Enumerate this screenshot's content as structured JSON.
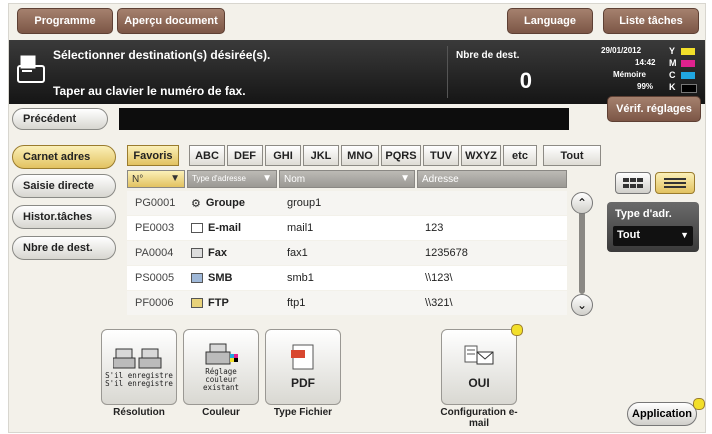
{
  "top_tabs": {
    "programme": "Programme",
    "apercu": "Aperçu document",
    "language": "Language",
    "liste": "Liste tâches"
  },
  "header": {
    "line1": "Sélectionner destination(s) désirée(s).",
    "line2": "Taper au clavier le numéro de fax.",
    "nbre_label": "Nbre de dest.",
    "nbre_value": "0",
    "datetime": "29/01/2012",
    "time": "14:42",
    "memory_label": "Mémoire",
    "memory_value": "99%",
    "toner": {
      "Y": "Y",
      "M": "M",
      "C": "C",
      "K": "K"
    },
    "verif": "Vérif. réglages"
  },
  "left": {
    "precedent": "Précédent",
    "items": [
      "Carnet adres",
      "Saisie directe",
      "Histor.tâches",
      "Nbre de dest."
    ]
  },
  "tabs": [
    "Favoris",
    "ABC",
    "DEF",
    "GHI",
    "JKL",
    "MNO",
    "PQRS",
    "TUV",
    "WXYZ",
    "etc",
    "Tout"
  ],
  "columns": {
    "no": "N°",
    "type": "Type d'adresse",
    "nom": "Nom",
    "adresse": "Adresse"
  },
  "rows": [
    {
      "no": "PG0001",
      "type": "Groupe",
      "nom": "group1",
      "adresse": ""
    },
    {
      "no": "PE0003",
      "type": "E-mail",
      "nom": "mail1",
      "adresse": "123"
    },
    {
      "no": "PA0004",
      "type": "Fax",
      "nom": "fax1",
      "adresse": "1235678"
    },
    {
      "no": "PS0005",
      "type": "SMB",
      "nom": "smb1",
      "adresse": "\\\\123\\"
    },
    {
      "no": "PF0006",
      "type": "FTP",
      "nom": "ftp1",
      "adresse": "\\\\321\\"
    }
  ],
  "right_panel": {
    "type_label": "Type d'adr.",
    "type_value": "Tout"
  },
  "bottom": {
    "resolution_tiny": "S'il enregistre S'il enregistre",
    "resolution": "Résolution",
    "couleur_tiny": "Réglage couleur existant",
    "couleur": "Couleur",
    "pdf": "PDF",
    "type_fichier": "Type Fichier",
    "oui": "OUI",
    "config": "Configuration e-mail",
    "application": "Application"
  },
  "colors": {
    "accent": "#e2c261",
    "brown": "#7c5646",
    "dark": "#151515"
  }
}
